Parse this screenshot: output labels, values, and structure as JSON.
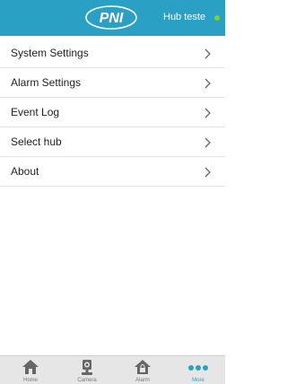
{
  "header": {
    "logo_text": "PNI",
    "hub_name": "Hub teste",
    "status_color": "#7ed321",
    "bar_color": "#2aa0c4"
  },
  "menu": {
    "items": [
      {
        "label": "System Settings",
        "icon": "chevron-right-icon"
      },
      {
        "label": "Alarm Settings",
        "icon": "chevron-right-icon"
      },
      {
        "label": "Event Log",
        "icon": "chevron-right-icon"
      },
      {
        "label": "Select hub",
        "icon": "chevron-right-icon"
      },
      {
        "label": "About",
        "icon": "chevron-right-icon"
      }
    ]
  },
  "tabs": [
    {
      "label": "Home",
      "icon": "home-icon",
      "active": false
    },
    {
      "label": "Camera",
      "icon": "camera-icon",
      "active": false
    },
    {
      "label": "Alarm",
      "icon": "alarm-icon",
      "active": false
    },
    {
      "label": "More",
      "icon": "more-icon",
      "active": true
    }
  ]
}
